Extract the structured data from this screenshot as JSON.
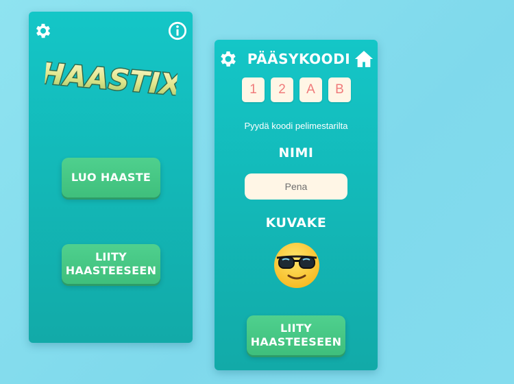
{
  "left_panel": {
    "logo_text": "HAASTIX",
    "create_button": "LUO HAASTE",
    "join_button_line1": "LIITY",
    "join_button_line2": "HAASTEESEEN",
    "icons": [
      "gear-icon",
      "info-icon"
    ]
  },
  "right_panel": {
    "title": "PÄÄSYKOODI",
    "code": [
      "1",
      "2",
      "A",
      "B"
    ],
    "hint": "Pyydä koodi pelimestarilta",
    "name_label": "NIMI",
    "name_value": "Pena",
    "avatar_label": "KUVAKE",
    "avatar": "sunglasses-emoji",
    "join_button_line1": "LIITY",
    "join_button_line2": "HAASTEESEEN",
    "icons": [
      "gear-icon",
      "home-icon"
    ]
  },
  "colors": {
    "background": "#84dcee",
    "panel": "#12b4b4",
    "button": "#45c685",
    "code_text": "#f07a7a",
    "input_bg": "#fff6e6"
  }
}
